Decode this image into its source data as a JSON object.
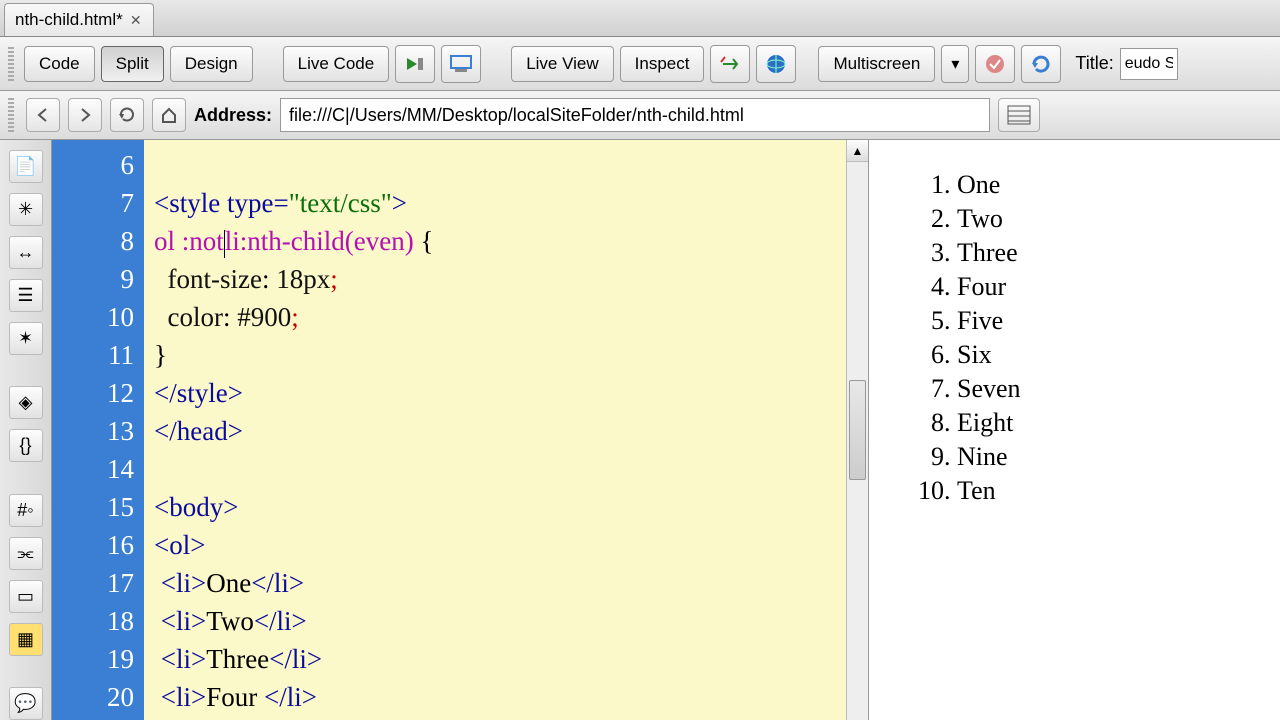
{
  "tab": {
    "title": "nth-child.html*"
  },
  "toolbar": {
    "code": "Code",
    "split": "Split",
    "design": "Design",
    "livecode": "Live Code",
    "liveview": "Live View",
    "inspect": "Inspect",
    "multiscreen": "Multiscreen",
    "title_label": "Title:",
    "title_value": "eudo S"
  },
  "address": {
    "label": "Address:",
    "value": "file:///C|/Users/MM/Desktop/localSiteFolder/nth-child.html"
  },
  "gutter": [
    "6",
    "7",
    "8",
    "9",
    "10",
    "11",
    "12",
    "13",
    "14",
    "15",
    "16",
    "17",
    "18",
    "19",
    "20"
  ],
  "code": {
    "l7_open": "<style ",
    "l7_attr": "type=",
    "l7_val": "\"text/css\"",
    "l7_close": ">",
    "l8_sel_a": "ol ",
    "l8_sel_b": ":not",
    "l8_sel_c": "li:nth-child(even)",
    "l8_brace": " {",
    "l9_prop": "font-size",
    "l9_colon": ": ",
    "l9_val": "18px",
    "l9_semi": ";",
    "l10_prop": "color",
    "l10_colon": ": ",
    "l10_val": "#900",
    "l10_semi": ";",
    "l11": "}",
    "l12": "</style>",
    "l13": "</head>",
    "l15": "<body>",
    "l16": "<ol>",
    "l17_open": "<li>",
    "l17_text": "One",
    "l17_close": "</li>",
    "l18_open": "<li>",
    "l18_text": "Two",
    "l18_close": "</li>",
    "l19_open": "<li>",
    "l19_text": "Three",
    "l19_close": "</li>",
    "l20_open": "<li>",
    "l20_text": "Four ",
    "l20_close": "</li>"
  },
  "preview": {
    "items": [
      "One",
      "Two",
      "Three",
      "Four",
      "Five",
      "Six",
      "Seven",
      "Eight",
      "Nine",
      "Ten"
    ]
  }
}
